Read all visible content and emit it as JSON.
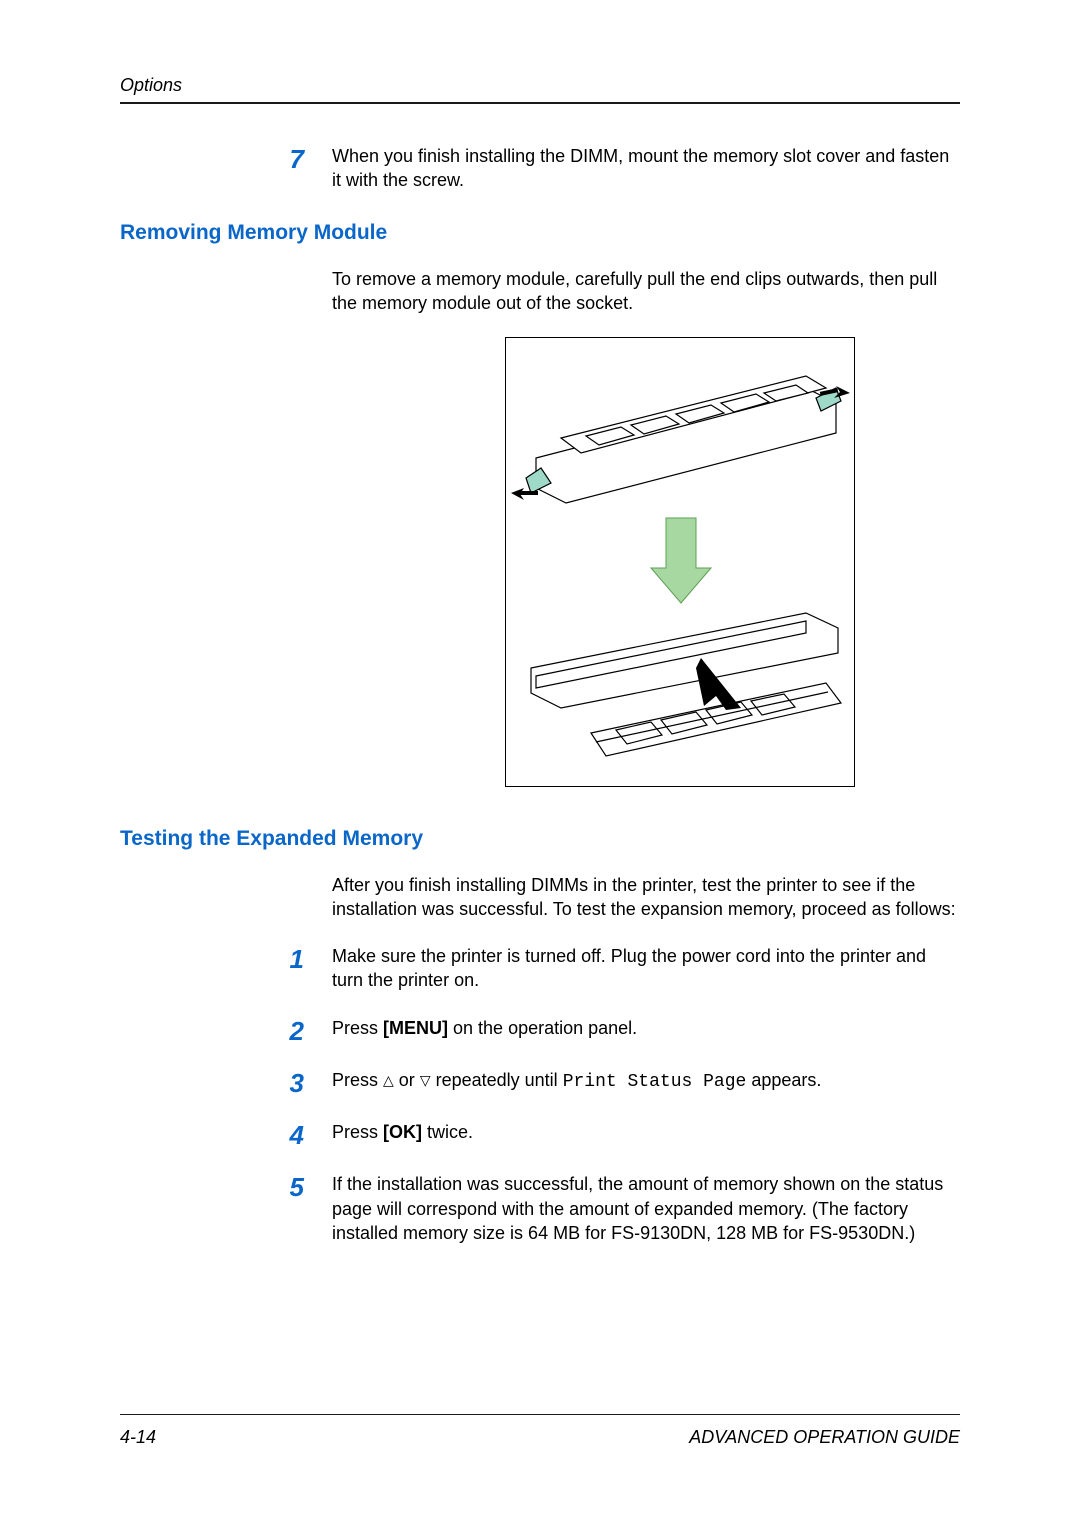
{
  "header": {
    "section": "Options"
  },
  "footer": {
    "page": "4-14",
    "book": "ADVANCED OPERATION GUIDE"
  },
  "step7": {
    "num": "7",
    "text": "When you finish installing the DIMM, mount the memory slot cover and fasten it with the screw."
  },
  "removing": {
    "heading": "Removing Memory Module",
    "para": "To remove a memory module, carefully pull the end clips outwards, then pull the memory module out of the socket."
  },
  "testing": {
    "heading": "Testing the Expanded Memory",
    "intro": "After you finish installing DIMMs in the printer, test the printer to see if the installation was successful. To test the expansion memory, proceed as follows:",
    "steps": {
      "s1": {
        "num": "1",
        "text": "Make sure the printer is turned off. Plug the power cord into the printer and turn the printer on."
      },
      "s2": {
        "num": "2",
        "pre": "Press ",
        "key": "[MENU]",
        "post": " on the operation panel."
      },
      "s3": {
        "num": "3",
        "pre": "Press ",
        "mid": " or ",
        "post_a": " repeatedly until ",
        "code": "Print Status Page",
        "post_b": " appears."
      },
      "s4": {
        "num": "4",
        "pre": "Press ",
        "key": "[OK]",
        "post": " twice."
      },
      "s5": {
        "num": "5",
        "text": "If the installation was successful, the amount of memory shown on the status page will correspond with the amount of expanded memory. (The factory installed memory size is 64 MB for FS-9130DN, 128 MB for FS-9530DN.)"
      }
    }
  }
}
